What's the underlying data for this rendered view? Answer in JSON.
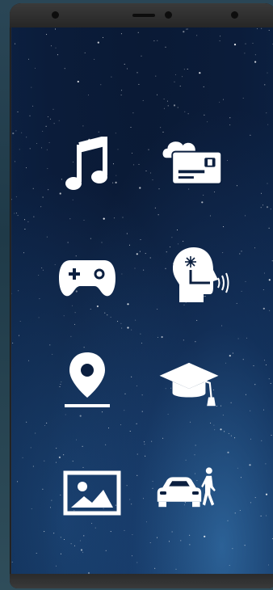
{
  "icons": {
    "music": "music-note-icon",
    "payment": "cloud-card-icon",
    "game": "gamepad-icon",
    "voice": "voice-assistant-icon",
    "location": "location-pin-icon",
    "education": "graduation-cap-icon",
    "gallery": "image-gallery-icon",
    "transport": "car-pedestrian-icon"
  },
  "colors": {
    "icon": "#ffffff",
    "frame": "#2b2b2b",
    "screen": "#0b1f3f"
  }
}
